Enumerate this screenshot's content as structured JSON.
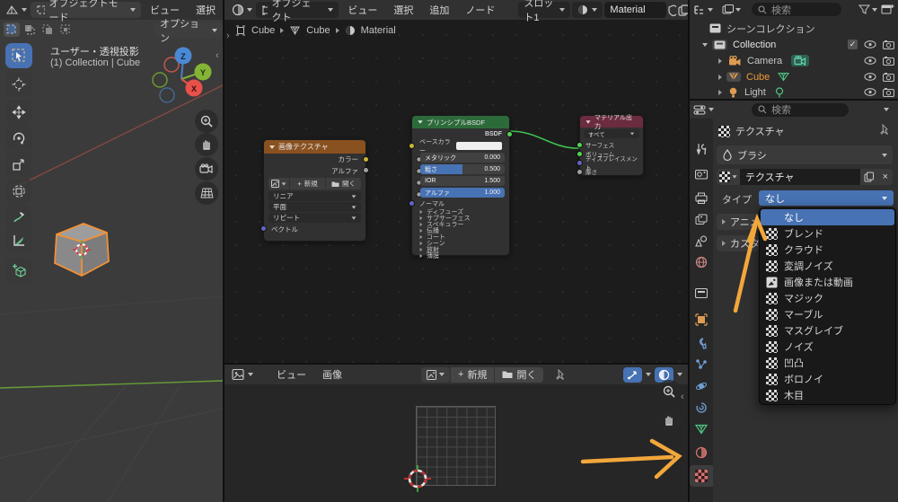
{
  "colors": {
    "accent": "#4772b3",
    "arrow": "#f2a73b",
    "selected_object": "#ee9a3c",
    "node_image_header": "#8a5120",
    "node_bsdf_header": "#2d6a3a",
    "node_output_header": "#6a2c3e"
  },
  "icons": {
    "close": "×",
    "plus": "+",
    "check": "✓",
    "collapse_left": "‹",
    "expand_right": "›"
  },
  "viewport3d": {
    "header": {
      "mode": "オブジェクトモード",
      "menus": [
        "ビュー",
        "選択"
      ],
      "options": "オプション"
    },
    "overlay": {
      "view": "ユーザー・透視投影",
      "breadcrumb": "(1) Collection | Cube"
    },
    "gizmo": {
      "x": "X",
      "y": "Y",
      "z": "Z"
    }
  },
  "shader_editor": {
    "header": {
      "object": "オブジェクト",
      "menus": [
        "ビュー",
        "選択",
        "追加",
        "ノード"
      ],
      "slot": "スロット1",
      "material": "Material"
    },
    "breadcrumb": {
      "object": "Cube",
      "data": "Cube",
      "material": "Material"
    },
    "nodes": {
      "image_texture": {
        "title": "画像テクスチャ",
        "color_out": "カラー",
        "alpha_out": "アルファ",
        "new": "新規",
        "open": "開く",
        "interpolation": "リニア",
        "projection": "平面",
        "extension": "リピート",
        "vector_in": "ベクトル"
      },
      "principled": {
        "title": "プリンシプルBSDF",
        "out": "BSDF",
        "base_color": "ベースカラー",
        "normal": "ノーマル",
        "sliders": [
          {
            "label": "メタリック",
            "value": "0.000"
          },
          {
            "label": "粗さ",
            "value": "0.500"
          },
          {
            "label": "IOR",
            "value": "1.500"
          },
          {
            "label": "アルファ",
            "value": "1.000"
          }
        ],
        "sections": [
          "ディフューズ",
          "サブサーフェス",
          "スペキュラー",
          "伝播",
          "コート",
          "シーン",
          "放射",
          "薄膜"
        ]
      },
      "material_output": {
        "title": "マテリアル出力",
        "target": "すべて",
        "inputs": [
          "サーフェス",
          "ボリューム",
          "ディスプレイスメント",
          "厚さ"
        ]
      }
    }
  },
  "image_editor": {
    "menus": [
      "ビュー",
      "画像"
    ],
    "new": "新規",
    "open": "開く"
  },
  "outliner": {
    "search_placeholder": "検索",
    "scene_collection": "シーンコレクション",
    "rows": [
      {
        "label": "Collection"
      },
      {
        "label": "Camera"
      },
      {
        "label": "Cube"
      },
      {
        "label": "Light"
      }
    ]
  },
  "properties": {
    "search_placeholder": "検索",
    "context": "テクスチャ",
    "brush_panel": "ブラシ",
    "texture_name": "テクスチャ",
    "type_label": "タイプ",
    "type_value": "なし",
    "panels": [
      "アニメ",
      "カスタ"
    ]
  },
  "texture_type_menu": {
    "items": [
      {
        "label": "なし"
      },
      {
        "label": "ブレンド"
      },
      {
        "label": "クラウド"
      },
      {
        "label": "変調ノイズ"
      },
      {
        "label": "画像または動画"
      },
      {
        "label": "マジック"
      },
      {
        "label": "マーブル"
      },
      {
        "label": "マスグレイブ"
      },
      {
        "label": "ノイズ"
      },
      {
        "label": "凹凸"
      },
      {
        "label": "ボロノイ"
      },
      {
        "label": "木目"
      }
    ]
  }
}
